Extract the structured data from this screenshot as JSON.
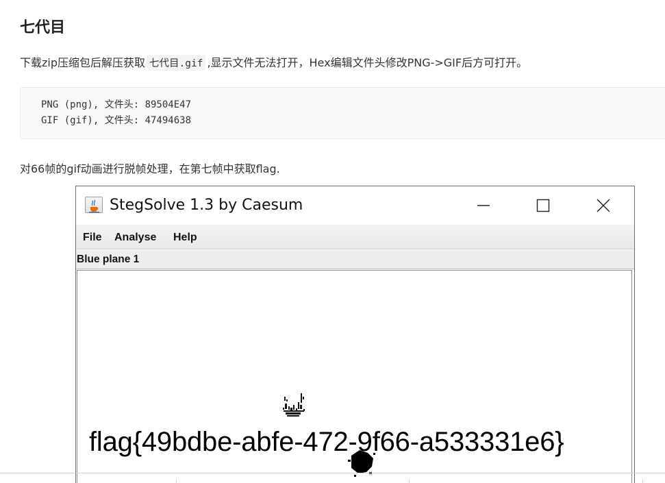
{
  "article": {
    "title": "七代目",
    "para1_before": "下载zip压缩包后解压获取",
    "para1_code": "七代目.gif",
    "para1_after": ",显示文件无法打开，Hex编辑文件头修改PNG->GIF后方可打开。",
    "code_lines": [
      "PNG (png), 文件头: 89504E47",
      "GIF (gif), 文件头: 47494638"
    ],
    "para2": "对66帧的gif动画进行脱帧处理，在第七帧中获取flag."
  },
  "window": {
    "title": "StegSolve 1.3 by Caesum",
    "app_icon": "java-cup-icon",
    "controls": [
      "minimize-icon",
      "maximize-icon",
      "close-icon"
    ],
    "menu": [
      "File",
      "Analyse",
      "Help"
    ],
    "panel_label": "Blue plane 1",
    "image_text": "flag{49bdbe-abfe-472-9f66-a533331e6}"
  }
}
